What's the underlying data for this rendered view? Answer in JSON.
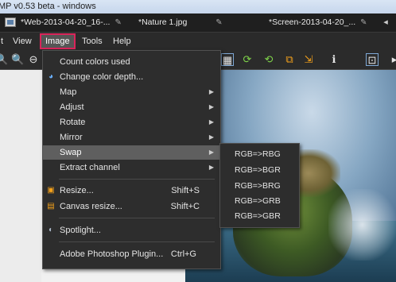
{
  "window": {
    "title": "MP v0.53 beta - windows"
  },
  "tabs": [
    {
      "label": "*Web-2013-04-20_16-..."
    },
    {
      "label": "*Nature 1.jpg"
    },
    {
      "label": "*Screen-2013-04-20_..."
    }
  ],
  "menubar": {
    "items": [
      {
        "label": "t"
      },
      {
        "label": "View"
      },
      {
        "label": "Image"
      },
      {
        "label": "Tools"
      },
      {
        "label": "Help"
      }
    ]
  },
  "image_menu": {
    "items": [
      {
        "label": "Count colors used"
      },
      {
        "label": "Change color depth..."
      },
      {
        "label": "Map"
      },
      {
        "label": "Adjust"
      },
      {
        "label": "Rotate"
      },
      {
        "label": "Mirror"
      },
      {
        "label": "Swap"
      },
      {
        "label": "Extract channel"
      },
      {
        "label": "Resize...",
        "shortcut": "Shift+S"
      },
      {
        "label": "Canvas resize...",
        "shortcut": "Shift+C"
      },
      {
        "label": "Spotlight..."
      },
      {
        "label": "Adobe Photoshop Plugin...",
        "shortcut": "Ctrl+G"
      }
    ]
  },
  "swap_submenu": {
    "items": [
      {
        "label": "RGB=>RBG"
      },
      {
        "label": "RGB=>BGR"
      },
      {
        "label": "RGB=>BRG"
      },
      {
        "label": "RGB=>GRB"
      },
      {
        "label": "RGB=>GBR"
      }
    ]
  },
  "icons": {
    "toolbar": [
      "zoom-in-icon",
      "zoom-out-icon",
      "palette-icon",
      "refresh-icon",
      "refresh-alt-icon",
      "crop-icon",
      "resize-icon",
      "info-icon",
      "fit-icon"
    ]
  },
  "colors": {
    "accent": "#d9245a",
    "menu_bg": "#2d2d2d",
    "highlight": "#5f5f5f"
  }
}
